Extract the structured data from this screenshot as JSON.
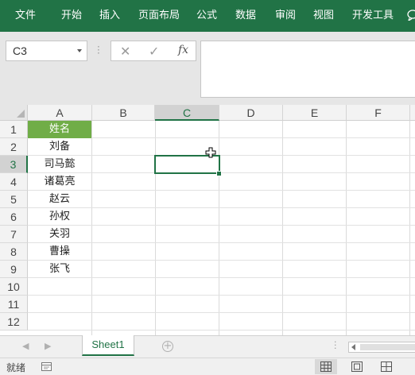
{
  "ribbon": {
    "tabs": [
      "文件",
      "开始",
      "插入",
      "页面布局",
      "公式",
      "数据",
      "审阅",
      "视图",
      "开发工具"
    ]
  },
  "formula_bar": {
    "name_box": "C3",
    "cancel_symbol": "✕",
    "enter_symbol": "✓",
    "fx_label": "fx",
    "value": ""
  },
  "grid": {
    "columns": [
      "A",
      "B",
      "C",
      "D",
      "E",
      "F"
    ],
    "selected_column": "C",
    "rows": [
      "1",
      "2",
      "3",
      "4",
      "5",
      "6",
      "7",
      "8",
      "9",
      "10",
      "11",
      "12"
    ],
    "selected_row": "3",
    "active_cell": "C3",
    "column_a_values": [
      "姓名",
      "刘备",
      "司马懿",
      "诸葛亮",
      "赵云",
      "孙权",
      "关羽",
      "曹操",
      "张飞"
    ],
    "header_fill_color": "#70ad47"
  },
  "sheet_tabs": {
    "tabs": [
      "Sheet1"
    ],
    "active": "Sheet1",
    "add_symbol": "+",
    "nav_prev": "◀",
    "nav_next": "▶"
  },
  "status_bar": {
    "status": "就绪"
  },
  "colors": {
    "ribbon": "#217346",
    "accent": "#217346",
    "header_cell": "#70ad47"
  },
  "icons": {
    "cursor": "cell-select-cross-cursor-icon",
    "macro": "macro-record-icon",
    "views": [
      "normal-view-icon",
      "page-layout-view-icon",
      "page-break-preview-icon"
    ]
  }
}
